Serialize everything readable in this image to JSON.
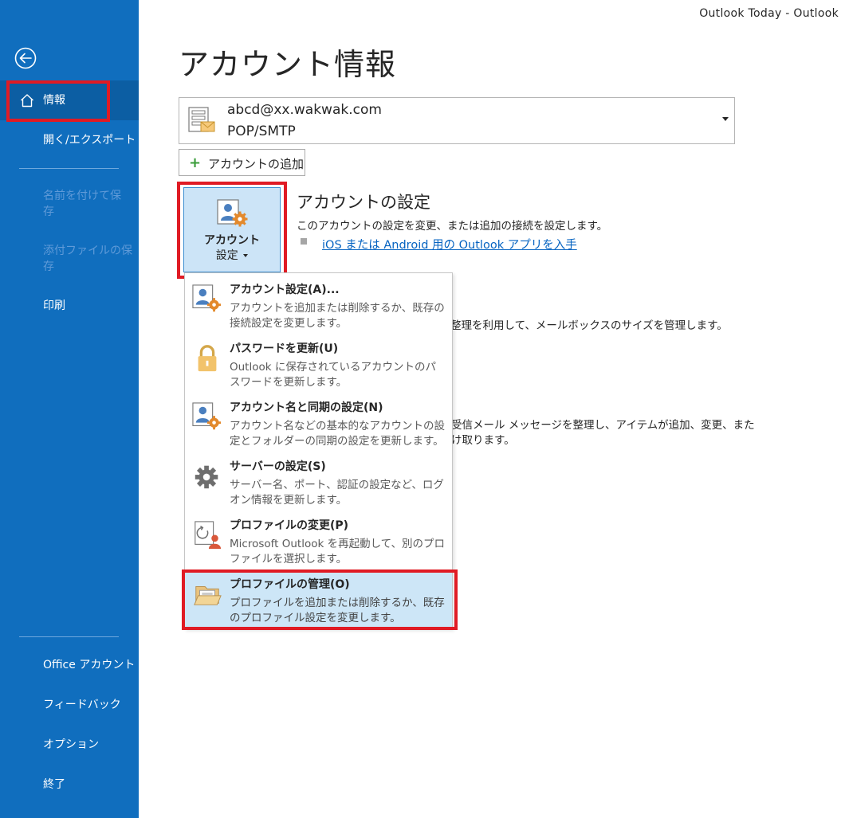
{
  "titlebar": {
    "text": "Outlook Today  -  Outlook"
  },
  "sidebar": {
    "back_icon": "back-arrow-icon",
    "items": [
      {
        "label": "情報"
      },
      {
        "label": "開く/エクスポート"
      },
      {
        "label": "名前を付けて保存",
        "line1": "名前を付けて保",
        "line2": "存"
      },
      {
        "label": "添付ファイルの保存",
        "line1": "添付ファイルの保",
        "line2": "存"
      },
      {
        "label": "印刷"
      },
      {
        "label": "Office アカウント"
      },
      {
        "label": "フィードバック"
      },
      {
        "label": "オプション"
      },
      {
        "label": "終了"
      }
    ]
  },
  "main": {
    "title": "アカウント情報",
    "account": {
      "email": "abcd@xx.wakwak.com",
      "type": "POP/SMTP"
    },
    "add_account_label": "アカウントの追加",
    "account_settings_button": {
      "line1": "アカウント",
      "line2": "設定"
    },
    "section": {
      "title": "アカウントの設定",
      "description": "このアカウントの設定を変更、または追加の接続を設定します。",
      "link": "iOS または Android 用の Outlook アプリを入手"
    },
    "background_text": [
      "整理を利用して、メールボックスのサイズを管理します。",
      "受信メール メッセージを整理し、アイテムが追加、変更、また",
      "け取ります。"
    ]
  },
  "menu": {
    "items": [
      {
        "title": "アカウント設定(A)...",
        "desc": "アカウントを追加または削除するか、既存の接続設定を変更します。",
        "icon": "account-settings-icon"
      },
      {
        "title": "パスワードを更新(U)",
        "desc": "Outlook に保存されているアカウントのパスワードを更新します。",
        "icon": "lock-icon"
      },
      {
        "title": "アカウント名と同期の設定(N)",
        "desc": "アカウント名などの基本的なアカウントの設定とフォルダーの同期の設定を更新します。",
        "icon": "account-sync-icon"
      },
      {
        "title": "サーバーの設定(S)",
        "desc": "サーバー名、ポート、認証の設定など、ログオン情報を更新します。",
        "icon": "gear-icon"
      },
      {
        "title": "プロファイルの変更(P)",
        "desc": "Microsoft Outlook を再起動して、別のプロファイルを選択します。",
        "icon": "change-profile-icon"
      },
      {
        "title": "プロファイルの管理(O)",
        "desc": "プロファイルを追加または削除するか、既存のプロファイル設定を変更します。",
        "icon": "manage-profiles-icon"
      }
    ]
  },
  "colors": {
    "sidebar": "#106ebe",
    "sidebar_active": "#0c5ea3",
    "highlight": "#cde6f7",
    "annotation_red": "#e01b24",
    "link": "#0563c1"
  }
}
